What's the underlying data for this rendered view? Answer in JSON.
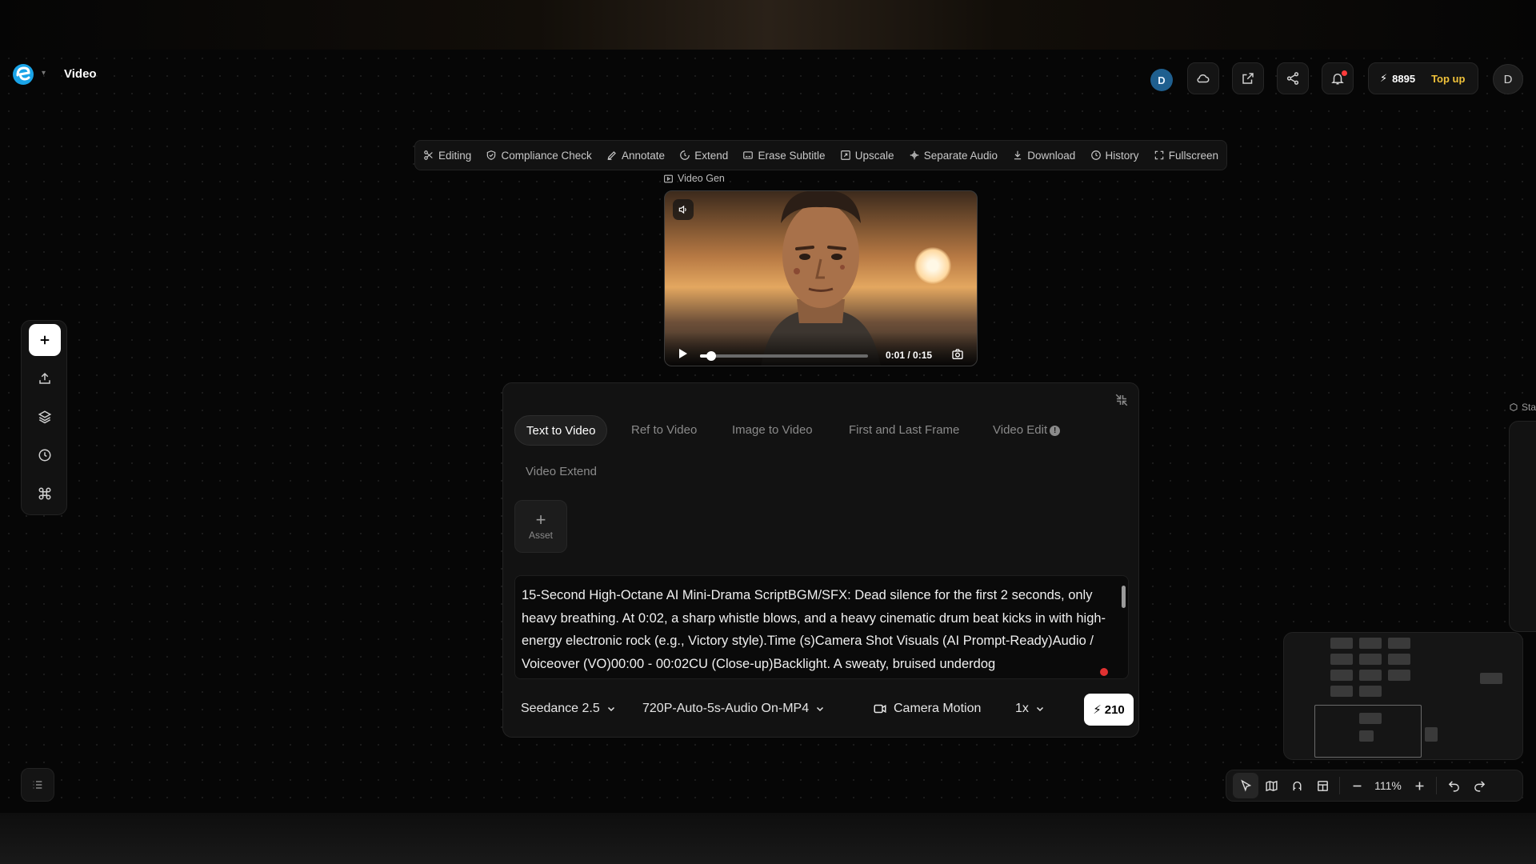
{
  "header": {
    "app_title": "Video",
    "user_initial_badge": "D",
    "credits": "8895",
    "topup_label": "Top up",
    "profile_initial": "D",
    "accent_color": "#f0c23a"
  },
  "toolbar": {
    "items": [
      {
        "label": "Editing",
        "icon": "scissors-icon"
      },
      {
        "label": "Compliance Check",
        "icon": "shield-check-icon"
      },
      {
        "label": "Annotate",
        "icon": "pen-icon"
      },
      {
        "label": "Extend",
        "icon": "extend-icon"
      },
      {
        "label": "Erase Subtitle",
        "icon": "subtitle-icon"
      },
      {
        "label": "Upscale",
        "icon": "upscale-icon"
      },
      {
        "label": "Separate Audio",
        "icon": "separate-audio-icon"
      },
      {
        "label": "Download",
        "icon": "download-icon"
      },
      {
        "label": "History",
        "icon": "clock-icon"
      },
      {
        "label": "Fullscreen",
        "icon": "fullscreen-icon"
      }
    ]
  },
  "video_card": {
    "label": "Video Gen",
    "time": "0:01 / 0:15",
    "progress": 0.067
  },
  "panel": {
    "tabs": [
      {
        "label": "Text to Video",
        "active": true
      },
      {
        "label": "Ref to Video",
        "active": false
      },
      {
        "label": "Image to Video",
        "active": false
      },
      {
        "label": "First and Last Frame",
        "active": false
      },
      {
        "label": "Video Edit",
        "active": false
      }
    ],
    "tab_extra": "Video Extend",
    "asset_label": "Asset",
    "prompt": "15-Second High-Octane AI Mini-Drama ScriptBGM/SFX: Dead silence for the first 2 seconds, only heavy breathing. At 0:02, a sharp whistle blows, and a heavy cinematic drum beat kicks in with high-energy electronic rock (e.g., Victory style).Time (s)Camera Shot Visuals (AI Prompt-Ready)Audio / Voiceover (VO)00:00 - 00:02CU (Close-up)Backlight. A sweaty, bruised underdog",
    "model": "Seedance 2.5",
    "format": "720P-Auto-5s-Audio On-MP4",
    "camera_motion": "Camera Motion",
    "speed": "1x",
    "cost": "210"
  },
  "right_edge_label": "Sta",
  "canvas_controls": {
    "zoom": "111%"
  }
}
